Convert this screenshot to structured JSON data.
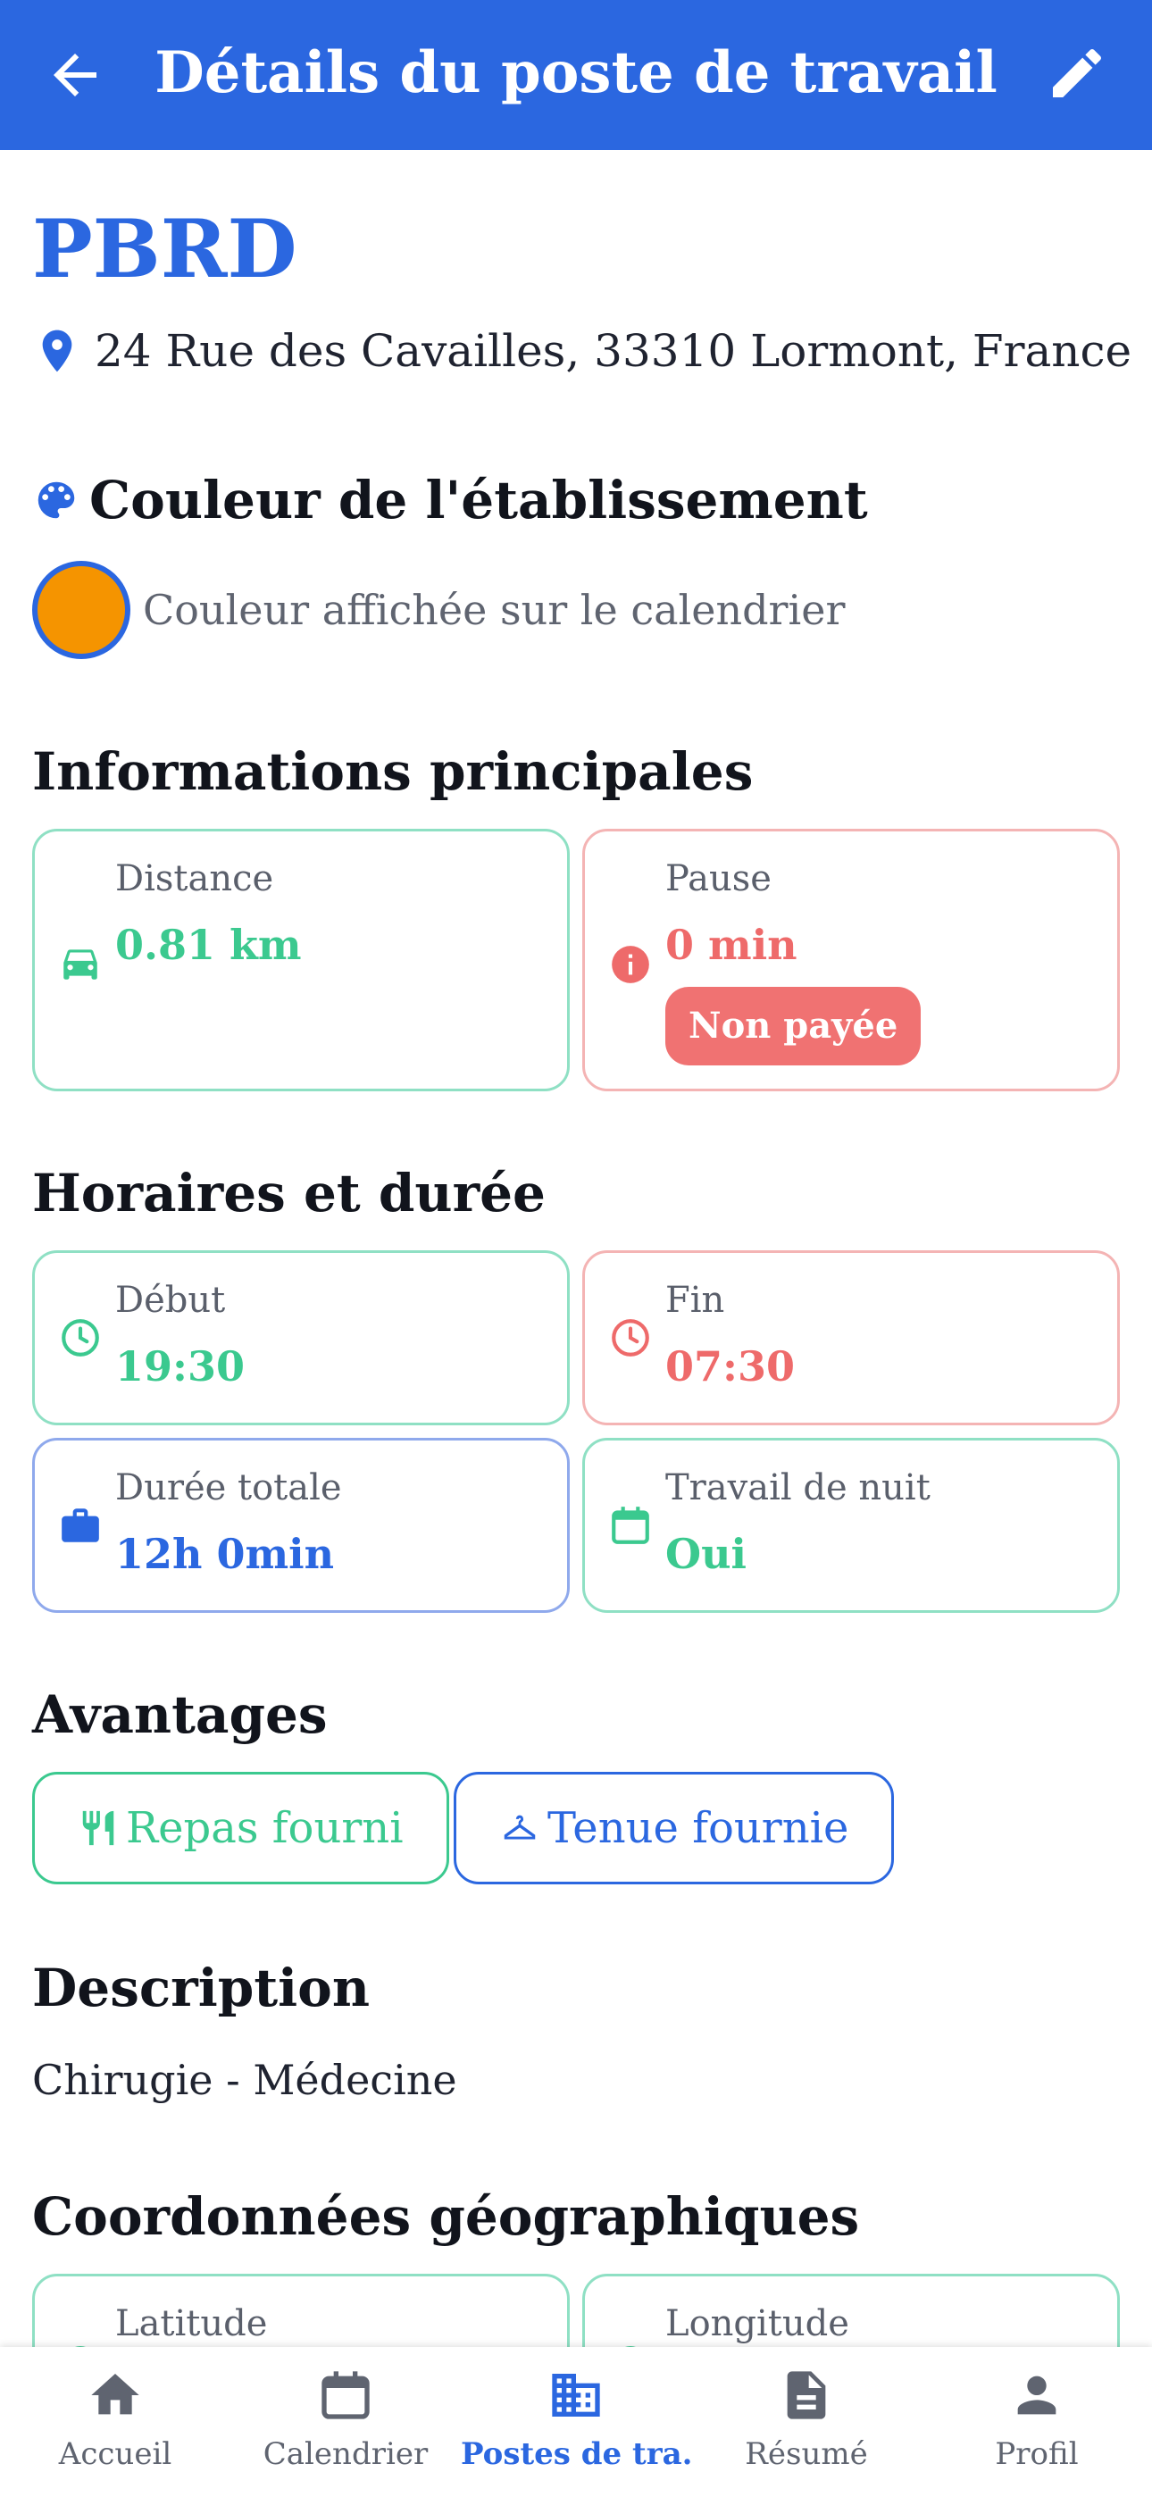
{
  "header": {
    "title": "Détails du poste de travail"
  },
  "place": {
    "name": "PBRD",
    "address": "24 Rue des Cavailles, 33310 Lormont, France"
  },
  "color_section": {
    "title": "Couleur de l'établissement",
    "caption": "Couleur affichée sur le calendrier",
    "swatch_color": "#f59400"
  },
  "main_info": {
    "title": "Informations principales",
    "distance": {
      "label": "Distance",
      "value": "0.81 km"
    },
    "pause": {
      "label": "Pause",
      "value": "0 min",
      "badge": "Non payée"
    }
  },
  "schedule": {
    "title": "Horaires et durée",
    "start": {
      "label": "Début",
      "value": "19:30"
    },
    "end": {
      "label": "Fin",
      "value": "07:30"
    },
    "total": {
      "label": "Durée totale",
      "value": "12h 0min"
    },
    "night": {
      "label": "Travail de nuit",
      "value": "Oui"
    }
  },
  "benefits": {
    "title": "Avantages",
    "meal": "Repas fourni",
    "outfit": "Tenue fournie"
  },
  "description": {
    "title": "Description",
    "text": "Chirugie - Médecine"
  },
  "geo": {
    "title": "Coordonnées géographiques",
    "latitude_label": "Latitude",
    "longitude_label": "Longitude"
  },
  "nav": {
    "items": [
      {
        "label": "Accueil",
        "icon": "home-icon"
      },
      {
        "label": "Calendrier",
        "icon": "calendar-icon"
      },
      {
        "label": "Postes de tra...",
        "icon": "building-icon"
      },
      {
        "label": "Résumé",
        "icon": "document-icon"
      },
      {
        "label": "Profil",
        "icon": "person-icon"
      }
    ]
  },
  "colors": {
    "primary": "#2b67e0",
    "green": "#3bc98f",
    "red": "#ee6a6a"
  }
}
